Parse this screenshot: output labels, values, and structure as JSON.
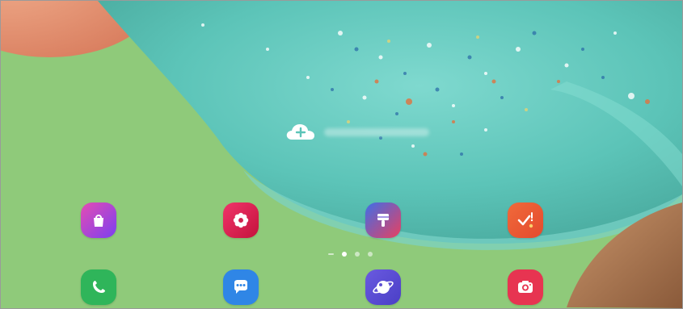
{
  "home_screen": {
    "weather_widget": {
      "icon": "cloud-plus-icon",
      "text": ""
    },
    "apps_row1": [
      {
        "name": "",
        "icon": "shopping-bag-icon",
        "color": "#b63fd0"
      },
      {
        "name": "",
        "icon": "flower-icon",
        "color": "#d0234d"
      },
      {
        "name": "",
        "icon": "paint-brush-icon",
        "color": "#6a4fd6"
      },
      {
        "name": "",
        "icon": "checkmark-icon",
        "color": "#ee5b32"
      }
    ],
    "page_indicator": {
      "pages": 3,
      "current": 1
    },
    "dock": [
      {
        "name": "",
        "icon": "phone-icon",
        "color": "#2fb55a"
      },
      {
        "name": "",
        "icon": "message-icon",
        "color": "#2f86e6"
      },
      {
        "name": "",
        "icon": "browser-icon",
        "color": "#5e50d3"
      },
      {
        "name": "",
        "icon": "camera-icon",
        "color": "#e73451"
      }
    ]
  }
}
